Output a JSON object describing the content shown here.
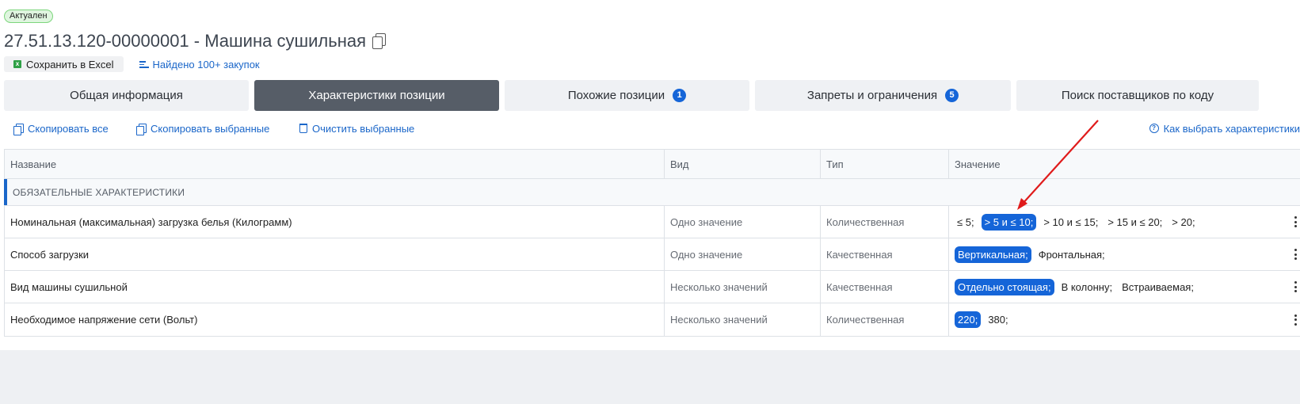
{
  "status_badge": "Актуален",
  "title": "27.51.13.120-00000001 - Машина сушильная",
  "actions": {
    "save_excel": "Сохранить в Excel",
    "found_purchases": "Найдено 100+ закупок"
  },
  "tabs": [
    {
      "label": "Общая информация",
      "count": ""
    },
    {
      "label": "Характеристики позиции",
      "count": ""
    },
    {
      "label": "Похожие позиции",
      "count": "1"
    },
    {
      "label": "Запреты и ограничения",
      "count": "5"
    },
    {
      "label": "Поиск поставщиков по коду",
      "count": ""
    }
  ],
  "toolbar": {
    "copy_all": "Скопировать все",
    "copy_selected": "Скопировать выбранные",
    "clear_selected": "Очистить выбранные",
    "how_to_choose": "Как выбрать характеристики"
  },
  "table": {
    "headers": [
      "Название",
      "Вид",
      "Тип",
      "Значение"
    ],
    "group": "ОБЯЗАТЕЛЬНЫЕ ХАРАКТЕРИСТИКИ",
    "rows": [
      {
        "name": "Номинальная (максимальная) загрузка белья (Килограмм)",
        "kind": "Одно значение",
        "type": "Количественная",
        "values": [
          {
            "text": "≤ 5;",
            "selected": false
          },
          {
            "text": "> 5 и ≤ 10;",
            "selected": true
          },
          {
            "text": "> 10 и ≤ 15;",
            "selected": false
          },
          {
            "text": "> 15 и ≤ 20;",
            "selected": false
          },
          {
            "text": "> 20;",
            "selected": false
          }
        ]
      },
      {
        "name": "Способ загрузки",
        "kind": "Одно значение",
        "type": "Качественная",
        "values": [
          {
            "text": "Вертикальная;",
            "selected": true
          },
          {
            "text": "Фронтальная;",
            "selected": false
          }
        ]
      },
      {
        "name": "Вид машины сушильной",
        "kind": "Несколько значений",
        "type": "Качественная",
        "values": [
          {
            "text": "Отдельно стоящая;",
            "selected": true
          },
          {
            "text": "В колонну;",
            "selected": false
          },
          {
            "text": "Встраиваемая;",
            "selected": false
          }
        ]
      },
      {
        "name": "Необходимое напряжение сети (Вольт)",
        "kind": "Несколько значений",
        "type": "Количественная",
        "values": [
          {
            "text": "220;",
            "selected": true
          },
          {
            "text": "380;",
            "selected": false
          }
        ]
      }
    ]
  },
  "colors": {
    "accent": "#1565d8",
    "active_tab": "#565d67",
    "arrow": "#e01b1b"
  }
}
